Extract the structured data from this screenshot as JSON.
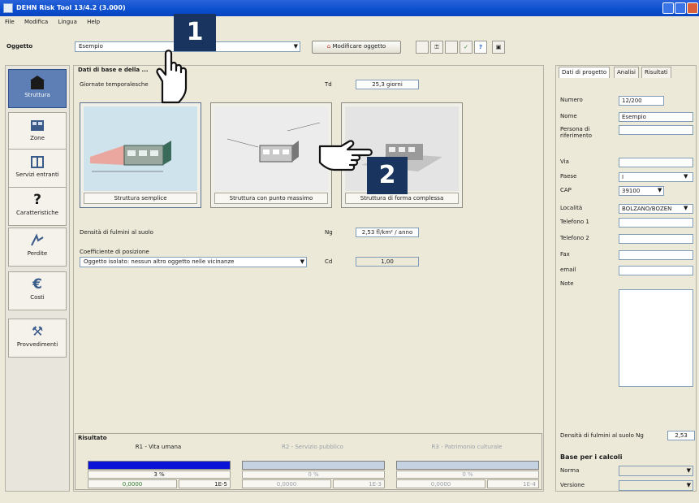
{
  "window": {
    "title": "DEHN Risk Tool 13/4.2 (3.000)"
  },
  "menu": [
    "File",
    "Modifica",
    "Lingua",
    "Help"
  ],
  "object_bar": {
    "label": "Oggetto",
    "value": "Esempio",
    "modify_button": "Modificare oggetto"
  },
  "sidebar": [
    {
      "label": "Struttura",
      "icon": "building-icon"
    },
    {
      "label": "Zone",
      "icon": "zones-icon"
    },
    {
      "label": "Servizi entranti",
      "icon": "services-icon"
    },
    {
      "label": "Caratteristiche",
      "icon": "question-icon"
    },
    {
      "label": "Perdite",
      "icon": "loss-icon"
    },
    {
      "label": "Costi",
      "icon": "euro-icon"
    },
    {
      "label": "Provvedimenti",
      "icon": "tools-icon"
    }
  ],
  "main": {
    "group_title": "Dati di base e della ...",
    "thunder_days": {
      "label": "Giornate temporalesche",
      "symbol": "Td",
      "value": "25,3 giorni"
    },
    "structures": [
      {
        "caption": "Struttura semplice"
      },
      {
        "caption": "Struttura con punto massimo"
      },
      {
        "caption": "Struttura di forma complessa"
      }
    ],
    "density": {
      "label": "Densità di fulmini al suolo",
      "symbol": "Ng",
      "value": "2,53 fl/km² / anno"
    },
    "position": {
      "label": "Coefficiente di posizione",
      "value": "Oggetto isolato: nessun altro oggetto nelle vicinanze",
      "symbol": "Cd",
      "coef": "1,00"
    }
  },
  "right_panel": {
    "tabs": [
      "Dati di progetto",
      "Analisi",
      "Risultati"
    ],
    "fields": [
      {
        "label": "Numero",
        "value": "12/200"
      },
      {
        "label": "Nome",
        "value": "Esempio"
      },
      {
        "label": "Persona di riferimento",
        "value": ""
      },
      {
        "label": "Via",
        "value": ""
      },
      {
        "label": "Paese",
        "value": "I"
      },
      {
        "label": "CAP",
        "value": "39100"
      },
      {
        "label": "Località",
        "value": "BOLZANO/BOZEN"
      },
      {
        "label": "Telefono 1",
        "value": ""
      },
      {
        "label": "Telefono 2",
        "value": ""
      },
      {
        "label": "Fax",
        "value": ""
      },
      {
        "label": "email",
        "value": ""
      },
      {
        "label": "Note",
        "value": ""
      }
    ],
    "density_label": "Densità di fulmini al suolo Ng",
    "density_value": "2,53",
    "basis_title": "Base per i calcoli",
    "norm_label": "Norma",
    "version_label": "Versione"
  },
  "results": {
    "title": "Risultato",
    "columns": [
      {
        "title": "R1 - Vita umana",
        "pct": "3 %",
        "val1": "0,0000",
        "val2": "1E-5",
        "fill": 1.0
      },
      {
        "title": "R2 - Servizio pubblico",
        "pct": "0 %",
        "val1": "0,0000",
        "val2": "1E-3",
        "fill": 0.0
      },
      {
        "title": "R3 - Patrimonio culturale",
        "pct": "0 %",
        "val1": "0,0000",
        "val2": "1E-4",
        "fill": 0.0
      }
    ]
  },
  "annotations": [
    {
      "number": "1"
    },
    {
      "number": "2"
    }
  ],
  "colors": {
    "titlebar": "#0a4fcf",
    "active": "#5d7fb5",
    "bar_fill": "#0a12d8",
    "badge": "#19355f"
  }
}
